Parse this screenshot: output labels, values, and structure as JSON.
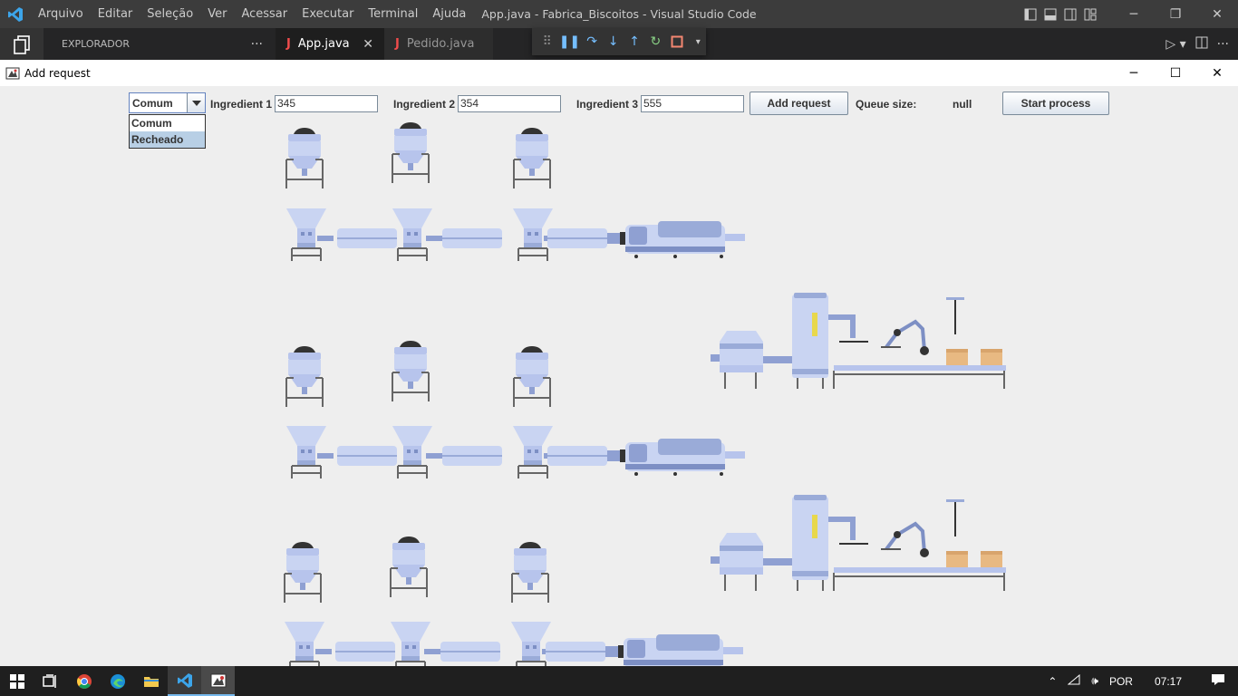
{
  "vscode": {
    "menu": [
      "Arquivo",
      "Editar",
      "Seleção",
      "Ver",
      "Acessar",
      "Executar",
      "Terminal",
      "Ajuda"
    ],
    "window_title": "App.java - Fabrica_Biscoitos - Visual Studio Code",
    "explorer_label": "EXPLORADOR",
    "explorer_more": "···",
    "tabs": [
      {
        "label": "App.java",
        "icon": "J",
        "active": true
      },
      {
        "label": "Pedido.java",
        "icon": "J",
        "active": false
      }
    ],
    "tab_close": "✕"
  },
  "java_window": {
    "title": "Add request",
    "combo": {
      "selected": "Comum",
      "options": [
        "Comum",
        "Recheado"
      ],
      "highlighted": "Recheado"
    },
    "ingredient1_label": "Ingredient 1",
    "ingredient1_value": "345",
    "ingredient2_label": "Ingredient 2",
    "ingredient2_value": "354",
    "ingredient3_label": "Ingredient 3",
    "ingredient3_value": "555",
    "add_request_button": "Add request",
    "queue_size_label": "Queue size:",
    "queue_size_value": "null",
    "start_process_button": "Start process"
  },
  "taskbar": {
    "language": "POR",
    "time": "07:17"
  },
  "colors": {
    "vscode_titlebar": "#3c3c3c",
    "vscode_tabbar": "#252526",
    "java_bg": "#eeeeee",
    "machine_light": "#c9d4f2",
    "machine_mid": "#9aabd8",
    "machine_dark": "#7d8fc4",
    "box": "#e8b982"
  }
}
